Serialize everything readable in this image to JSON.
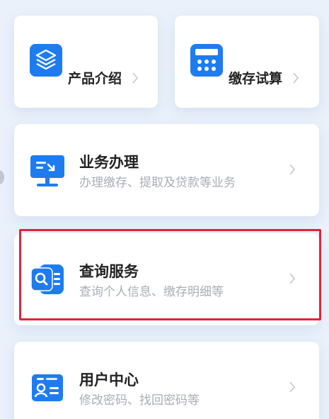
{
  "colors": {
    "background": "#eaf1fb",
    "card": "#ffffff",
    "icon_blue": "#1e7cf0",
    "title": "#222222",
    "subtitle": "#a9adb5",
    "highlight": "#e2243a"
  },
  "cards": {
    "product": {
      "title": "产品介绍",
      "icon": "layers-icon"
    },
    "calc": {
      "title": "缴存试算",
      "icon": "calculator-icon"
    },
    "business": {
      "title": "业务办理",
      "subtitle": "办理缴存、提取及贷款等业务",
      "icon": "monitor-icon"
    },
    "query": {
      "title": "查询服务",
      "subtitle": "查询个人信息、缴存明细等",
      "icon": "search-document-icon"
    },
    "user": {
      "title": "用户中心",
      "subtitle": "修改密码、找回密码等",
      "icon": "id-card-icon"
    }
  }
}
